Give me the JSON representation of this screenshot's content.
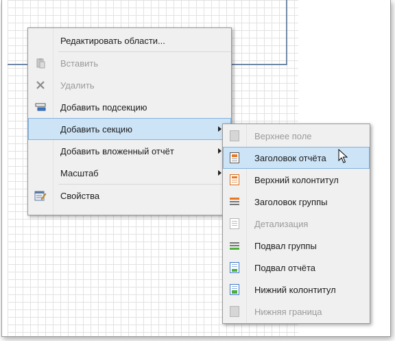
{
  "context_menu": {
    "items": [
      {
        "label": "Редактировать области...",
        "enabled": true,
        "icon": ""
      },
      {
        "label": "Вставить",
        "enabled": false,
        "icon": "paste-icon"
      },
      {
        "label": "Удалить",
        "enabled": false,
        "icon": "delete-icon"
      },
      {
        "label": "Добавить подсекцию",
        "enabled": true,
        "icon": "add-subband-icon"
      },
      {
        "label": "Добавить секцию",
        "enabled": true,
        "icon": "",
        "submenu": true,
        "highlighted": true
      },
      {
        "label": "Добавить вложенный отчёт",
        "enabled": true,
        "icon": "",
        "submenu": true
      },
      {
        "label": "Масштаб",
        "enabled": true,
        "icon": "",
        "submenu": true
      },
      {
        "label": "Свойства",
        "enabled": true,
        "icon": "properties-icon"
      }
    ]
  },
  "submenu": {
    "items": [
      {
        "label": "Верхнее поле",
        "enabled": false,
        "icon": "top-margin-icon"
      },
      {
        "label": "Заголовок отчёта",
        "enabled": true,
        "icon": "report-header-icon",
        "highlighted": true
      },
      {
        "label": "Верхний колонтитул",
        "enabled": true,
        "icon": "page-header-icon"
      },
      {
        "label": "Заголовок группы",
        "enabled": true,
        "icon": "group-header-icon"
      },
      {
        "label": "Детализация",
        "enabled": false,
        "icon": "detail-icon"
      },
      {
        "label": "Подвал группы",
        "enabled": true,
        "icon": "group-footer-icon"
      },
      {
        "label": "Подвал отчёта",
        "enabled": true,
        "icon": "report-footer-icon"
      },
      {
        "label": "Нижний колонтитул",
        "enabled": true,
        "icon": "page-footer-icon"
      },
      {
        "label": "Нижняя граница",
        "enabled": false,
        "icon": "bottom-margin-icon"
      }
    ]
  },
  "colors": {
    "highlight": "#cde4f7",
    "highlight_border": "#7fb3e0",
    "band_border": "#7088a8"
  }
}
